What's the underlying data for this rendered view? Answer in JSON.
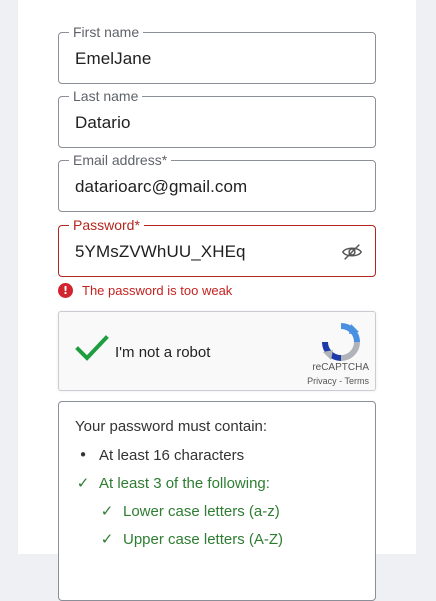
{
  "form": {
    "first_name": {
      "label": "First name",
      "value": "EmelJane"
    },
    "last_name": {
      "label": "Last name",
      "value": "Datario"
    },
    "email": {
      "label": "Email address*",
      "value": "datarioarc@gmail.com"
    },
    "password": {
      "label": "Password*",
      "value": "5YMsZVWhUU_XHEq",
      "icon": "eye-slash-icon"
    },
    "error": {
      "icon": "error-icon",
      "text": "The password is too weak",
      "color": "#c5221f"
    }
  },
  "captcha": {
    "label": "I'm not a robot",
    "checked": true,
    "brand": "reCAPTCHA",
    "privacy": "Privacy",
    "separator": " - ",
    "terms": "Terms"
  },
  "requirements": {
    "heading": "Your password must contain:",
    "items": [
      {
        "mark": "•",
        "text": "At least 16 characters",
        "met": false
      },
      {
        "mark": "✓",
        "text": "At least 3 of the following:",
        "met": true
      },
      {
        "mark": "✓",
        "text": "Lower case letters (a-z)",
        "met": true
      },
      {
        "mark": "✓",
        "text": "Upper case letters (A-Z)",
        "met": true
      }
    ],
    "ok_color": "#2e7d32"
  }
}
